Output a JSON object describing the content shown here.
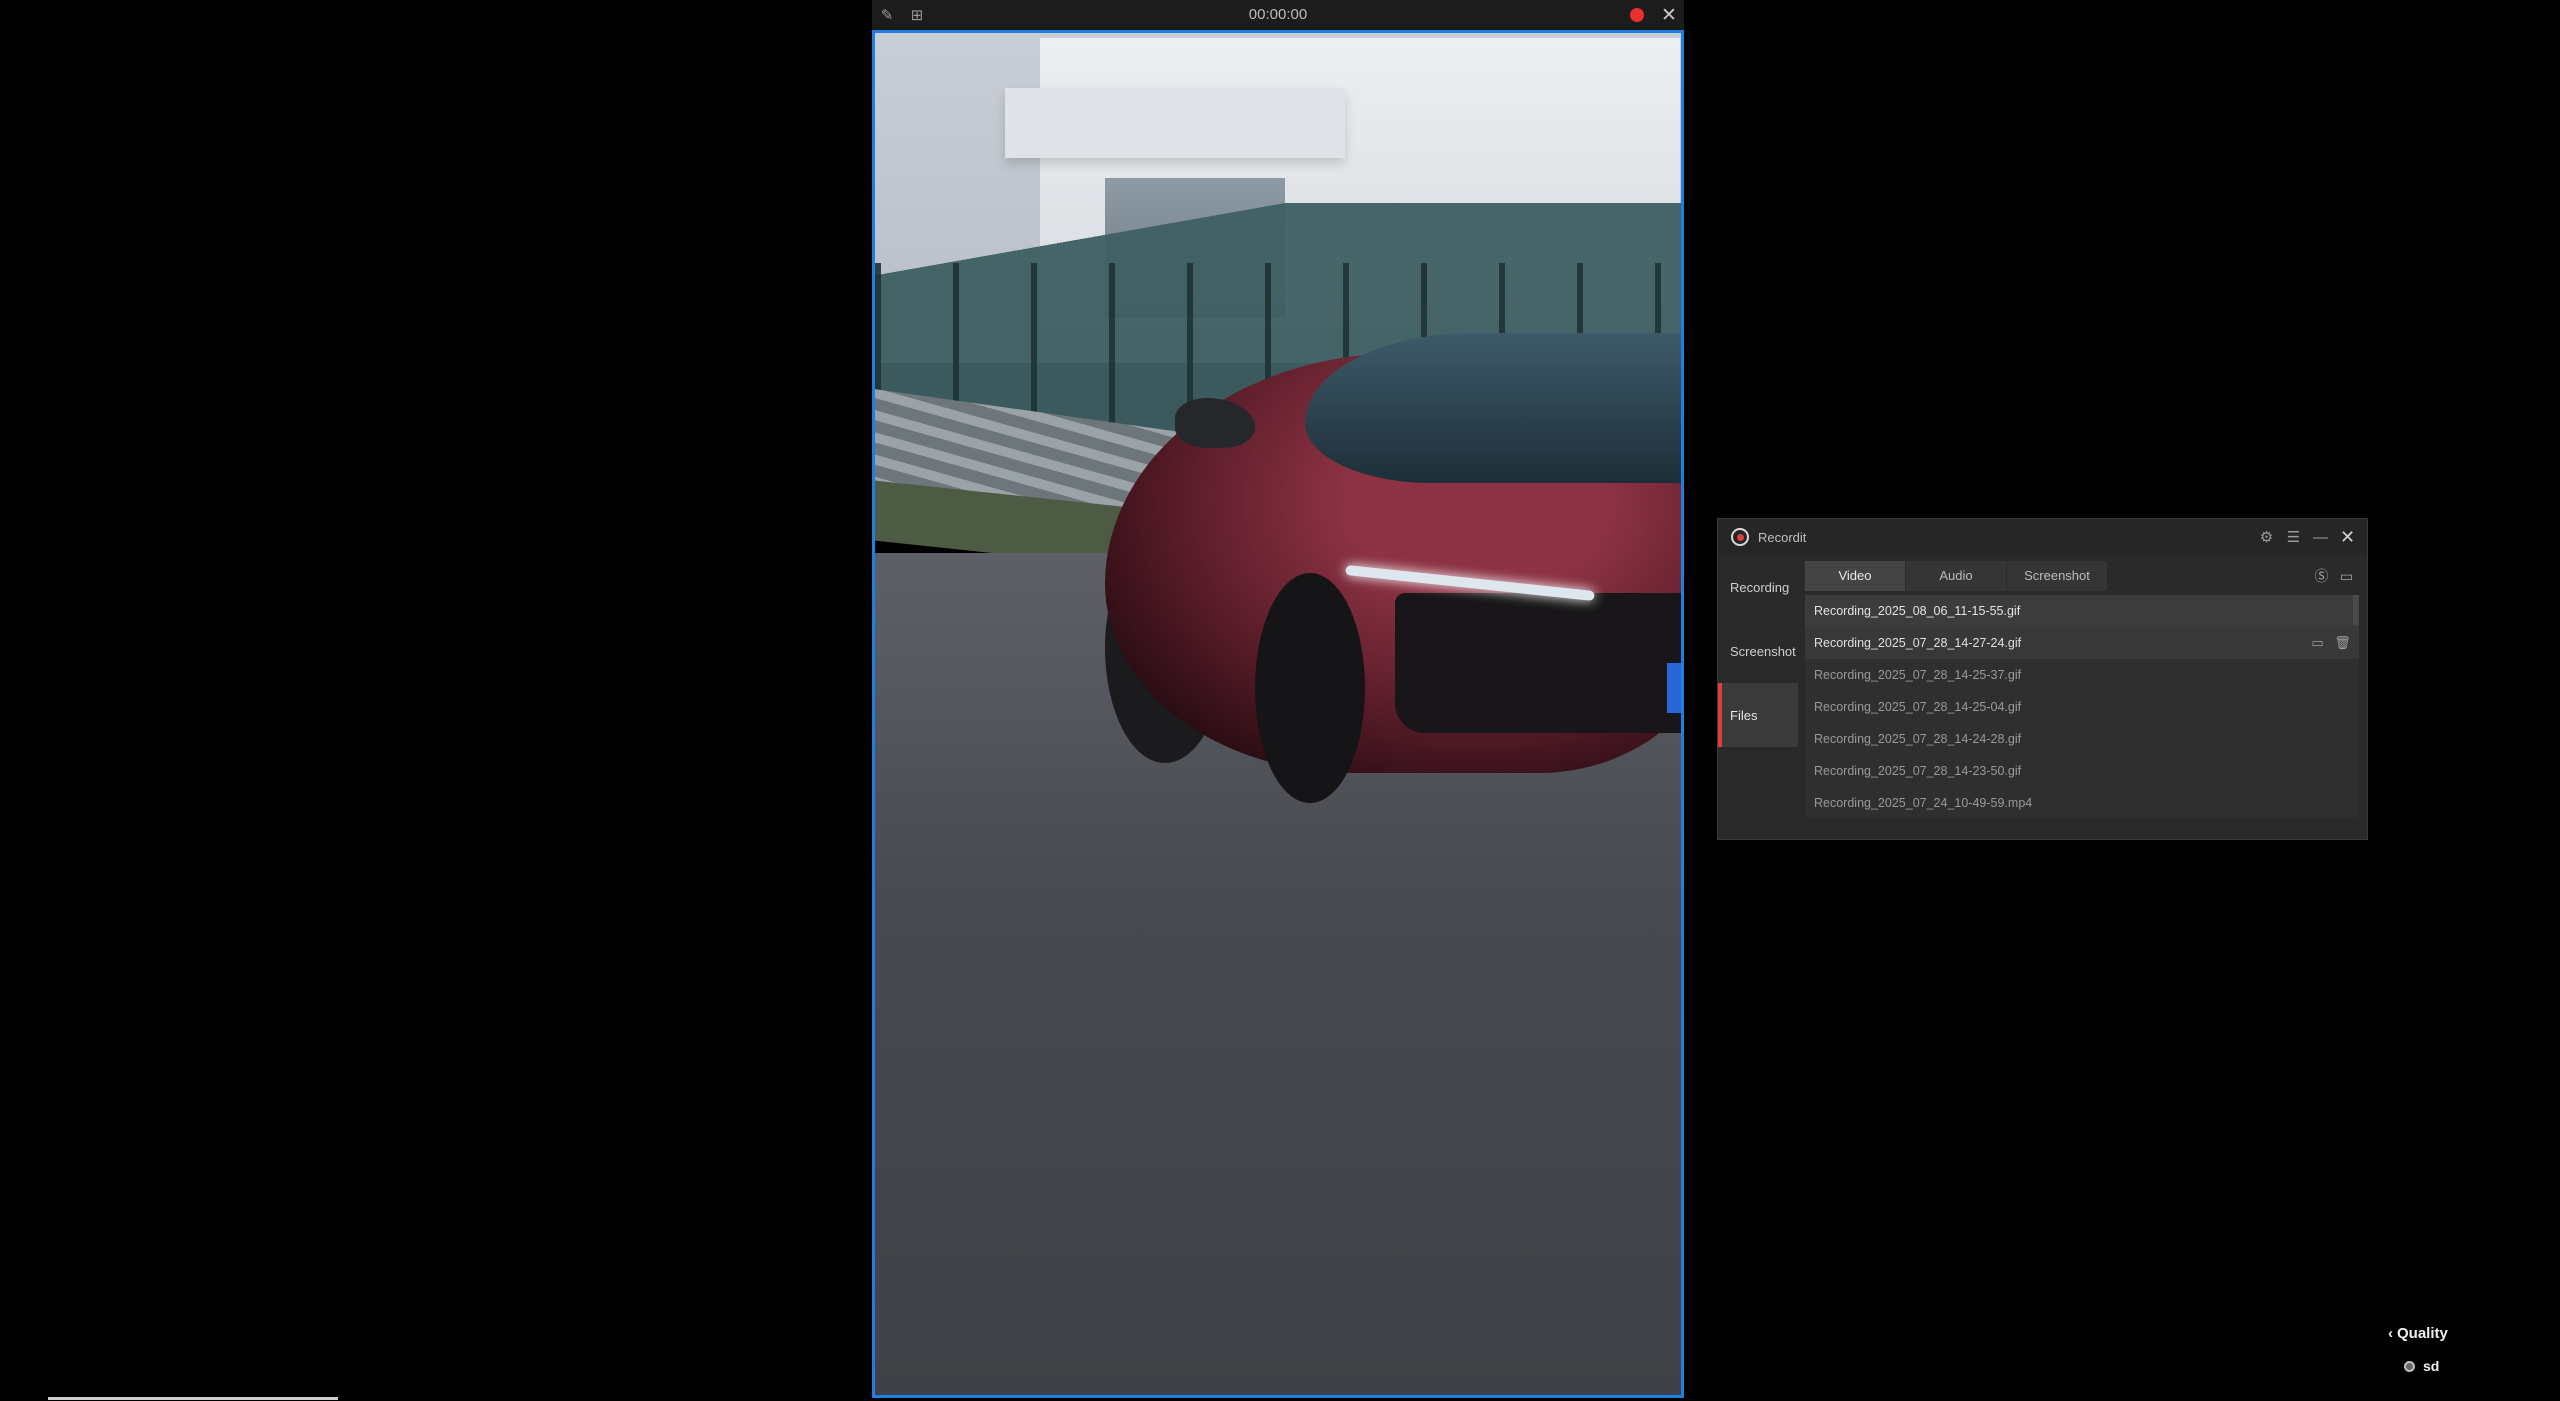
{
  "overlay": {
    "timer": "00:00:00",
    "icons": {
      "pen": "pen-icon",
      "crop": "crop-icon",
      "record": "record-dot-icon",
      "close": "close-icon"
    }
  },
  "app": {
    "name": "Recordit",
    "title_icons": [
      "settings-icon",
      "menu-icon",
      "minimize-icon",
      "close-icon"
    ],
    "sidebar": [
      {
        "label": "Recording",
        "active": false
      },
      {
        "label": "Screenshot",
        "active": false
      },
      {
        "label": "Files",
        "active": true
      }
    ],
    "tabs": [
      {
        "label": "Video",
        "active": true
      },
      {
        "label": "Audio",
        "active": false
      },
      {
        "label": "Screenshot",
        "active": false
      }
    ],
    "tab_tools": [
      "dollar-circle-icon",
      "folder-icon"
    ],
    "files": [
      "Recording_2025_08_06_11-15-55.gif",
      "Recording_2025_07_28_14-27-24.gif",
      "Recording_2025_07_28_14-25-37.gif",
      "Recording_2025_07_28_14-25-04.gif",
      "Recording_2025_07_28_14-24-28.gif",
      "Recording_2025_07_28_14-23-50.gif",
      "Recording_2025_07_24_10-49-59.mp4"
    ],
    "accent_color": "#e03c3c"
  },
  "quality": {
    "title": "Quality",
    "option": "sd"
  },
  "colors": {
    "frame_border": "#1f7fe0",
    "record": "#e8302f"
  }
}
